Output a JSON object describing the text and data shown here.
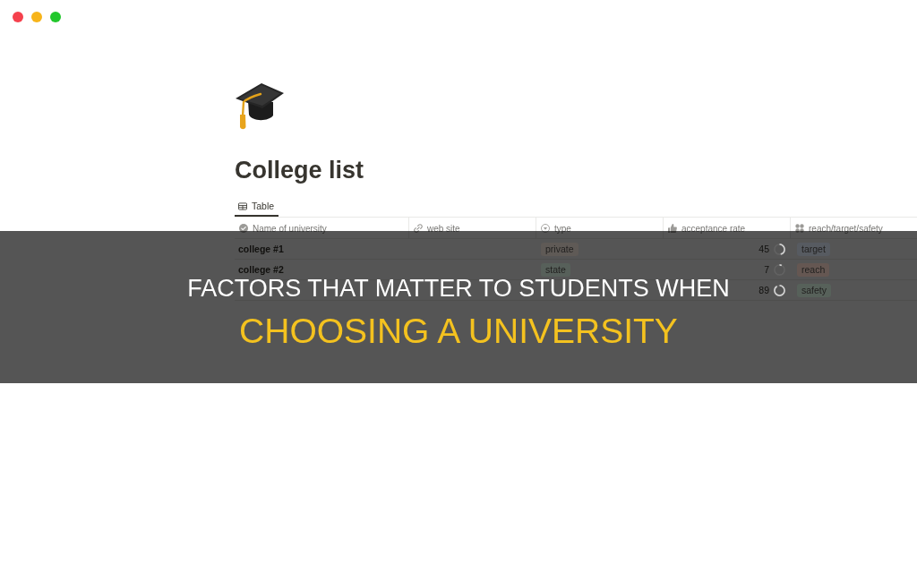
{
  "window": {
    "buttons": [
      {
        "color": "#f5414d"
      },
      {
        "color": "#f7b41a"
      },
      {
        "color": "#22c72c"
      }
    ]
  },
  "page": {
    "title": "College list",
    "views": [
      {
        "label": "Table",
        "selected": true
      }
    ]
  },
  "table": {
    "columns": [
      {
        "label": "Name of university",
        "kind": "title"
      },
      {
        "label": "web site",
        "kind": "url"
      },
      {
        "label": "type",
        "kind": "select"
      },
      {
        "label": "acceptance rate",
        "kind": "number"
      },
      {
        "label": "reach/target/safety",
        "kind": "multi_select"
      }
    ],
    "rows": [
      {
        "name": "college #1",
        "type": {
          "label": "private",
          "color": "#5f5a56"
        },
        "acceptance": "45",
        "category": [
          {
            "label": "target",
            "color": "#575b61"
          }
        ]
      },
      {
        "name": "college #2",
        "type": {
          "label": "state",
          "color": "#57605a"
        },
        "acceptance": "7",
        "category": [
          {
            "label": "reach",
            "color": "#655752"
          }
        ]
      },
      {
        "acceptance": "89",
        "category": [
          {
            "label": "safety",
            "color": "#57615a"
          }
        ]
      }
    ]
  },
  "banner": {
    "lines": [
      {
        "text": "FACTORS THAT MATTER TO STUDENTS WHEN",
        "kind": "plain"
      },
      {
        "text": "CHOOSING A UNIVERSITY",
        "kind": "highlight"
      }
    ]
  }
}
